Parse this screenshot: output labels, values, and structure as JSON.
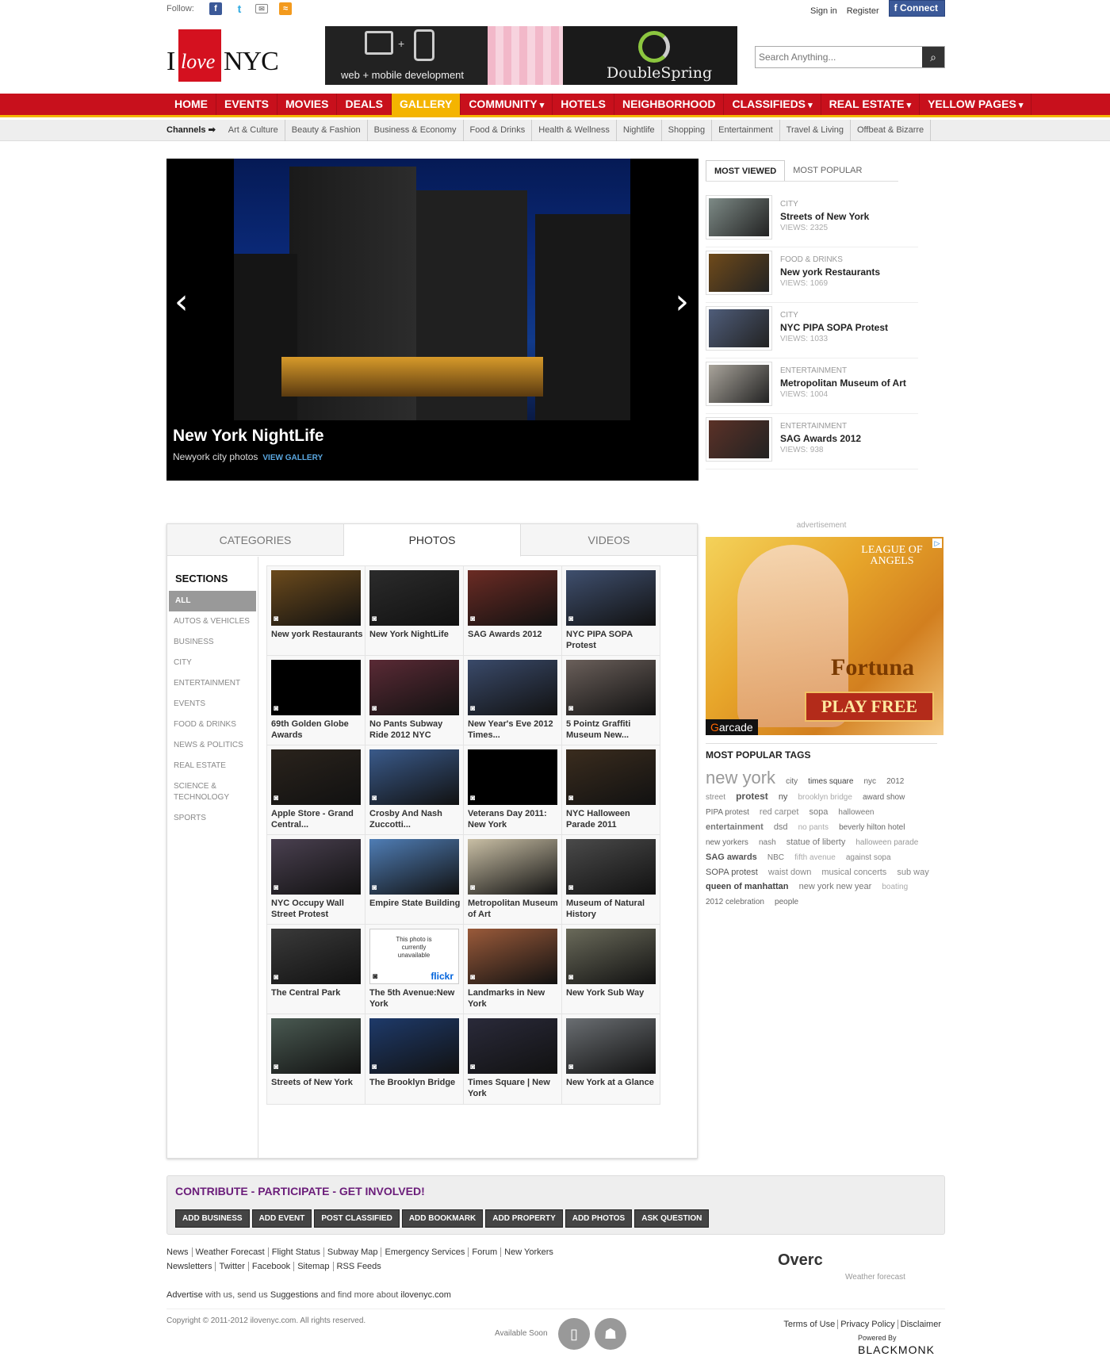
{
  "topbar": {
    "follow_label": "Follow:",
    "sign_in": "Sign in",
    "register": "Register",
    "connect": "Connect"
  },
  "header": {
    "logo_i": "I",
    "logo_love": "love",
    "logo_nyc": "NYC",
    "banner_left": "web + mobile development",
    "banner_right": "DoubleSpring",
    "search_placeholder": "Search Anything..."
  },
  "nav": [
    "HOME",
    "EVENTS",
    "MOVIES",
    "DEALS",
    "GALLERY",
    "COMMUNITY",
    "HOTELS",
    "NEIGHBORHOOD",
    "CLASSIFIEDS",
    "REAL ESTATE",
    "YELLOW PAGES"
  ],
  "channels": {
    "label": "Channels ➡",
    "items": [
      "Art & Culture",
      "Beauty & Fashion",
      "Business & Economy",
      "Food & Drinks",
      "Health & Wellness",
      "Nightlife",
      "Shopping",
      "Entertainment",
      "Travel & Living",
      "Offbeat & Bizarre"
    ]
  },
  "slider": {
    "title": "New York NightLife",
    "subtitle": "Newyork city photos",
    "link": "VIEW GALLERY"
  },
  "sidebar": {
    "tabs": [
      "MOST VIEWED",
      "MOST POPULAR"
    ],
    "items": [
      {
        "cat": "CITY",
        "title": "Streets of New York",
        "views": "VIEWS: 2325",
        "color": "#7d8a86"
      },
      {
        "cat": "FOOD & DRINKS",
        "title": "New york Restaurants",
        "views": "VIEWS: 1069",
        "color": "#6f4a1a"
      },
      {
        "cat": "CITY",
        "title": "NYC PIPA SOPA Protest",
        "views": "VIEWS: 1033",
        "color": "#4f5d7a"
      },
      {
        "cat": "ENTERTAINMENT",
        "title": "Metropolitan Museum of Art",
        "views": "VIEWS: 1004",
        "color": "#a9a49b"
      },
      {
        "cat": "ENTERTAINMENT",
        "title": "SAG Awards 2012",
        "views": "VIEWS: 938",
        "color": "#5b3127"
      }
    ],
    "ad_label": "advertisement",
    "ad": {
      "top": "LEAGUE OF ANGELS",
      "title": "Fortuna",
      "cta": "PLAY FREE",
      "brand": "arcade"
    },
    "tags_heading": "MOST POPULAR TAGS",
    "tags": [
      {
        "t": "new york",
        "s": 22,
        "w": "normal",
        "c": "#999"
      },
      {
        "t": "city",
        "s": 10,
        "w": "normal",
        "c": "#666"
      },
      {
        "t": "times square",
        "s": 10,
        "w": "normal",
        "c": "#444"
      },
      {
        "t": "nyc",
        "s": 10,
        "w": "normal",
        "c": "#666"
      },
      {
        "t": "2012",
        "s": 10,
        "w": "normal",
        "c": "#666"
      },
      {
        "t": "street",
        "s": 10,
        "w": "normal",
        "c": "#888"
      },
      {
        "t": "protest",
        "s": 12,
        "w": "bold",
        "c": "#555"
      },
      {
        "t": "ny",
        "s": 11,
        "w": "normal",
        "c": "#555"
      },
      {
        "t": "brooklyn bridge",
        "s": 10,
        "w": "normal",
        "c": "#aaa"
      },
      {
        "t": "award show",
        "s": 10,
        "w": "normal",
        "c": "#666"
      },
      {
        "t": "PIPA protest",
        "s": 10,
        "w": "normal",
        "c": "#666"
      },
      {
        "t": "red carpet",
        "s": 11,
        "w": "normal",
        "c": "#888"
      },
      {
        "t": "sopa",
        "s": 11,
        "w": "normal",
        "c": "#777"
      },
      {
        "t": "halloween",
        "s": 10,
        "w": "normal",
        "c": "#777"
      },
      {
        "t": "entertainment",
        "s": 11,
        "w": "bold",
        "c": "#777"
      },
      {
        "t": "dsd",
        "s": 11,
        "w": "normal",
        "c": "#777"
      },
      {
        "t": "no pants",
        "s": 10,
        "w": "normal",
        "c": "#aaa"
      },
      {
        "t": "beverly hilton hotel",
        "s": 10,
        "w": "normal",
        "c": "#666"
      },
      {
        "t": "new yorkers",
        "s": 10,
        "w": "normal",
        "c": "#666"
      },
      {
        "t": "nash",
        "s": 10,
        "w": "normal",
        "c": "#777"
      },
      {
        "t": "statue of liberty",
        "s": 11,
        "w": "normal",
        "c": "#777"
      },
      {
        "t": "halloween parade",
        "s": 10,
        "w": "normal",
        "c": "#999"
      },
      {
        "t": "SAG awards",
        "s": 11,
        "w": "bold",
        "c": "#555"
      },
      {
        "t": "NBC",
        "s": 10,
        "w": "normal",
        "c": "#777"
      },
      {
        "t": "fifth avenue",
        "s": 10,
        "w": "normal",
        "c": "#aaa"
      },
      {
        "t": "against sopa",
        "s": 10,
        "w": "normal",
        "c": "#888"
      },
      {
        "t": "SOPA protest",
        "s": 11,
        "w": "normal",
        "c": "#555"
      },
      {
        "t": "waist down",
        "s": 11,
        "w": "normal",
        "c": "#888"
      },
      {
        "t": "musical concerts",
        "s": 11,
        "w": "normal",
        "c": "#888"
      },
      {
        "t": "sub way",
        "s": 11,
        "w": "normal",
        "c": "#888"
      },
      {
        "t": "queen of manhattan",
        "s": 11,
        "w": "bold",
        "c": "#444"
      },
      {
        "t": "new york new year",
        "s": 11,
        "w": "normal",
        "c": "#777"
      },
      {
        "t": "boating",
        "s": 10,
        "w": "normal",
        "c": "#aaa"
      },
      {
        "t": "2012 celebration",
        "s": 10,
        "w": "normal",
        "c": "#666"
      },
      {
        "t": "people",
        "s": 10,
        "w": "normal",
        "c": "#666"
      }
    ]
  },
  "box": {
    "tabs": [
      "CATEGORIES",
      "PHOTOS",
      "VIDEOS"
    ],
    "sections_heading": "SECTIONS",
    "sections": [
      "ALL",
      "AUTOS & VEHICLES",
      "BUSINESS",
      "CITY",
      "ENTERTAINMENT",
      "EVENTS",
      "FOOD & DRINKS",
      "NEWS & POLITICS",
      "REAL ESTATE",
      "SCIENCE & TECHNOLOGY",
      "SPORTS"
    ],
    "photos": [
      {
        "cap": "New york Restaurants",
        "color": "#6b4a1c"
      },
      {
        "cap": "New York NightLife",
        "color": "#2b2b2b"
      },
      {
        "cap": "SAG Awards 2012",
        "color": "#6b2b24"
      },
      {
        "cap": "NYC PIPA SOPA Protest",
        "color": "#3f4f6e"
      },
      {
        "cap": "69th Golden Globe Awards",
        "color": "#000000"
      },
      {
        "cap": "No Pants Subway Ride 2012 NYC",
        "color": "#5a2a35"
      },
      {
        "cap": "New Year's Eve 2012 Times...",
        "color": "#3a4a6a"
      },
      {
        "cap": "5 Pointz Graffiti Museum New...",
        "color": "#6a5f5a"
      },
      {
        "cap": "Apple Store - Grand Central...",
        "color": "#2a231c"
      },
      {
        "cap": "Crosby And Nash Zuccotti...",
        "color": "#3a5a8a"
      },
      {
        "cap": "Veterans Day 2011: New York",
        "color": "#000000"
      },
      {
        "cap": "NYC Halloween Parade 2011",
        "color": "#3a2c1e"
      },
      {
        "cap": "NYC Occupy Wall Street Protest",
        "color": "#4a4050"
      },
      {
        "cap": "Empire State Building",
        "color": "#4f7db5"
      },
      {
        "cap": "Metropolitan Museum of Art",
        "color": "#c9bfa5"
      },
      {
        "cap": "Museum of Natural History",
        "color": "#4a4a4a"
      },
      {
        "cap": "The Central Park",
        "color": "#3a3a3a"
      },
      {
        "cap": "The 5th Avenue:New York",
        "color": "#ffffff"
      },
      {
        "cap": "Landmarks in New York",
        "color": "#9a5a3a"
      },
      {
        "cap": "New York Sub Way",
        "color": "#6a6a5a"
      },
      {
        "cap": "Streets of New York",
        "color": "#4a5a52"
      },
      {
        "cap": "The Brooklyn Bridge",
        "color": "#1e3a6a"
      },
      {
        "cap": "Times Square | New York",
        "color": "#2a2a3a"
      },
      {
        "cap": "New York at a Glance",
        "color": "#6a6e72"
      }
    ],
    "flickr_text": "This photo is currently unavailable",
    "flickr_brand": "flickr"
  },
  "contrib": {
    "heading": "CONTRIBUTE - PARTICIPATE - GET INVOLVED!",
    "buttons": [
      "ADD BUSINESS",
      "ADD EVENT",
      "POST CLASSIFIED",
      "ADD BOOKMARK",
      "ADD PROPERTY",
      "ADD PHOTOS",
      "ASK QUESTION"
    ]
  },
  "footer": {
    "row1": [
      "News",
      "Weather Forecast",
      "Flight Status",
      "Subway Map",
      "Emergency Services",
      "Forum",
      "New Yorkers"
    ],
    "row2": [
      "Newsletters",
      "Twitter",
      "Facebook",
      "Sitemap",
      "RSS Feeds"
    ],
    "advertise_a": "Advertise",
    "advertise_b": " with us, send us ",
    "advertise_c": "Suggestions",
    "advertise_d": " and find more about ",
    "advertise_e": "ilovenyc.com",
    "weather": "Overc",
    "weather_label": "Weather forecast",
    "copyright": "Copyright © 2011-2012 ilovenyc.com. All rights reserved.",
    "available": "Available Soon",
    "right_links": [
      "Terms of Use",
      "Privacy Policy",
      "Disclaimer"
    ],
    "powered": "Powered By",
    "brand": "BLACKMONK"
  }
}
